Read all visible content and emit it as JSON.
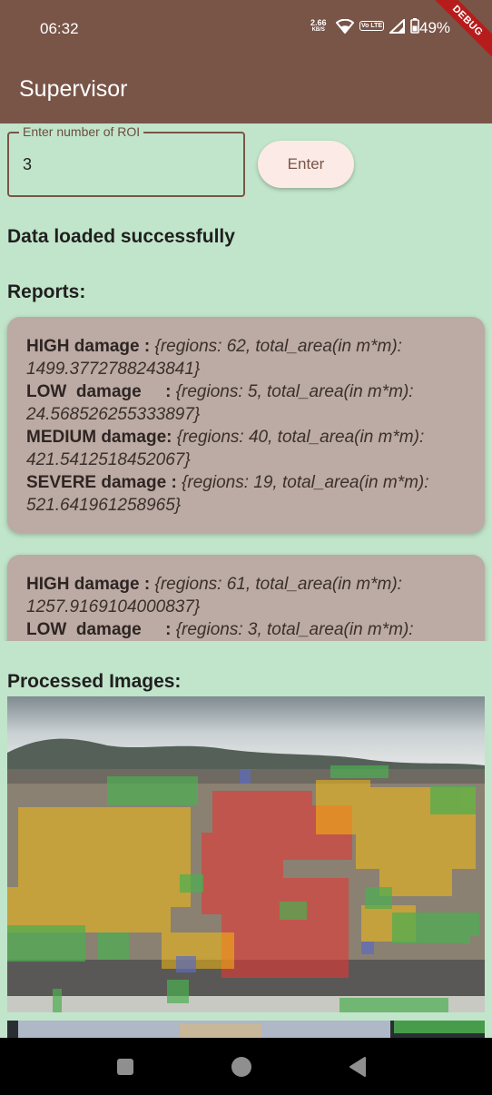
{
  "status_bar": {
    "time": "06:32",
    "net_speed": "2.66",
    "net_unit": "KB/S",
    "volte": "Vo LTE",
    "battery": "49%",
    "debug": "DEBUG"
  },
  "app_bar": {
    "title": "Supervisor"
  },
  "roi_input": {
    "label": "Enter  number of ROI",
    "value": "3"
  },
  "enter_button": {
    "label": "Enter"
  },
  "status_message": "Data loaded successfully",
  "reports_heading": "Reports:",
  "reports": [
    {
      "lines": [
        {
          "label": "HIGH damage : ",
          "value": "{regions: 62, total_area(in m*m):",
          "cont": "1499.3772788243841}"
        },
        {
          "label": "LOW  damage     : ",
          "value": "{regions: 5, total_area(in m*m):",
          "cont": "24.568526255333897}"
        },
        {
          "label": "MEDIUM damage: ",
          "value": "{regions: 40, total_area(in m*m):",
          "cont": "421.5412518452067}"
        },
        {
          "label": "SEVERE  damage : ",
          "value": "{regions: 19, total_area(in m*m):",
          "cont": "521.641961258965}"
        }
      ]
    },
    {
      "lines": [
        {
          "label": "HIGH damage : ",
          "value": "{regions: 61, total_area(in m*m):",
          "cont": "1257.9169104000837}"
        },
        {
          "label": "LOW  damage     : ",
          "value": "{regions: 3, total_area(in m*m):",
          "cont": ""
        }
      ]
    }
  ],
  "images_heading": "Processed Images:",
  "colors": {
    "app_bar": "#795548",
    "background": "#c1e5ca",
    "card": "#bcaaa4",
    "overlay_red": "#e53935",
    "overlay_yellow": "#ffc107",
    "overlay_green": "#4caf50",
    "overlay_blue": "#5c6bc0"
  }
}
